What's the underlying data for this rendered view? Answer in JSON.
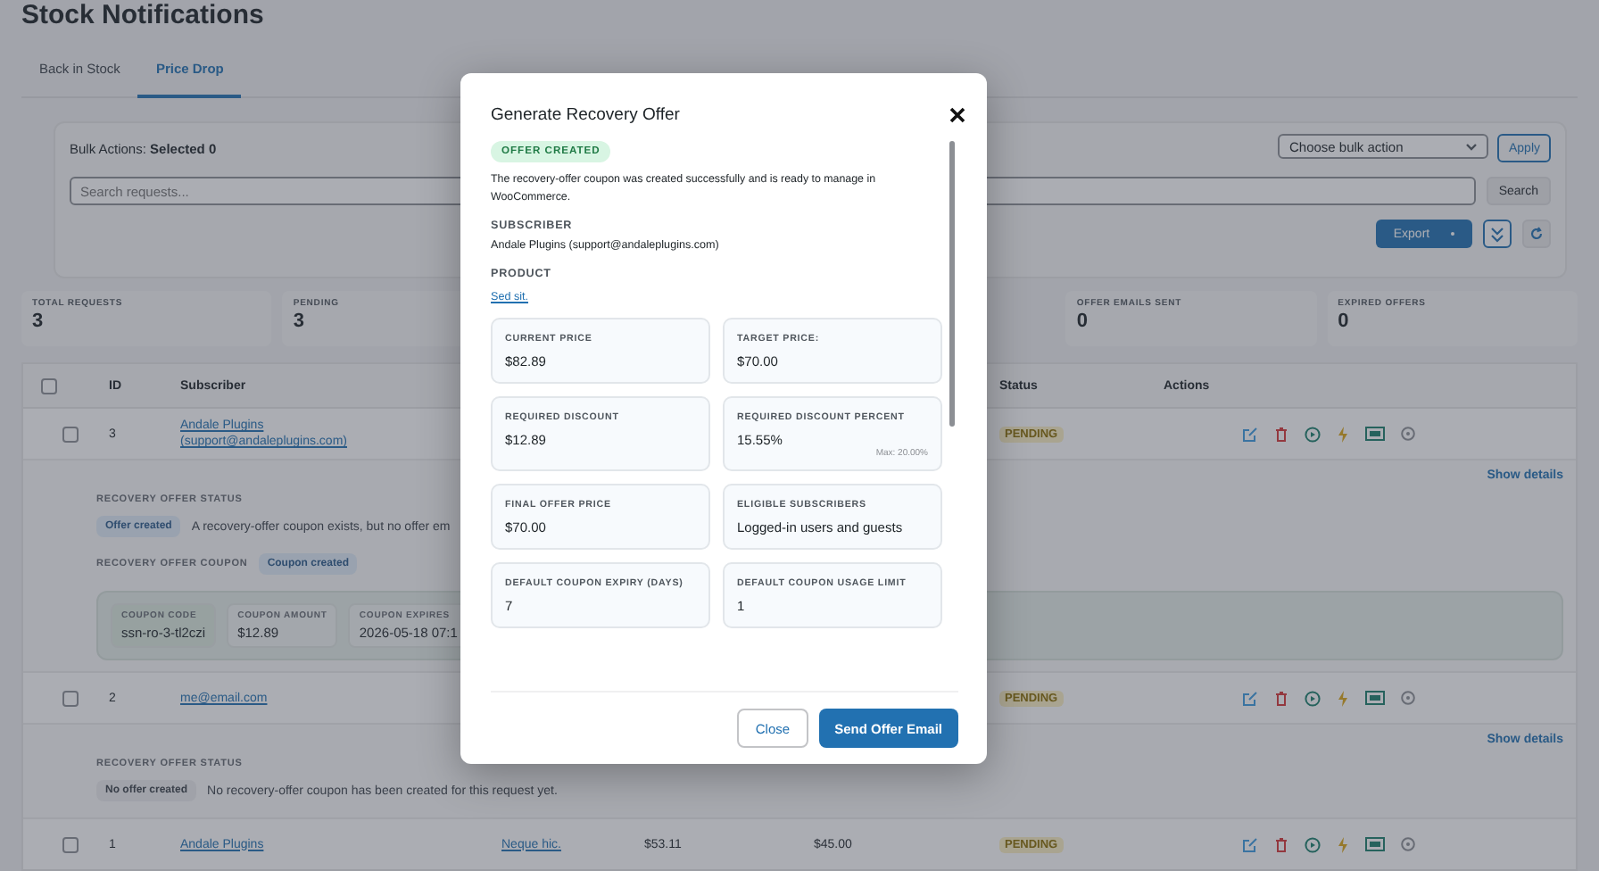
{
  "page": {
    "title": "Stock Notifications"
  },
  "tabs": [
    {
      "label": "Back in Stock",
      "selected": false
    },
    {
      "label": "Price Drop",
      "selected": true
    }
  ],
  "toolbar": {
    "bulk_label": "Bulk Actions: **Selected 0**",
    "bulk_select": "Choose bulk action",
    "apply": "Apply",
    "search_placeholder": "Search requests...",
    "search_button": "Search",
    "export": "Export"
  },
  "stats_left": [
    {
      "label": "TOTAL REQUESTS",
      "value": "3"
    },
    {
      "label": "PENDING",
      "value": "3"
    }
  ],
  "stats_right": [
    {
      "label": "OFFER EMAILS SENT",
      "value": "0"
    },
    {
      "label": "EXPIRED OFFERS",
      "value": "0"
    }
  ],
  "table": {
    "select_all_checked": false,
    "headers": {
      "id": "ID",
      "subscriber": "Subscriber",
      "status": "Status",
      "actions": "Actions"
    },
    "rows": [
      {
        "id": "3",
        "checked": false,
        "subscriber": "Andale Plugins (support@andaleplugins.com)",
        "status": "PENDING",
        "details": {
          "toggle": "Show details",
          "status_heading": "RECOVERY OFFER STATUS",
          "status_badge": {
            "label": "Offer created",
            "kind": "created"
          },
          "status_text": "A recovery-offer coupon exists, but no offer em",
          "coupon": {
            "heading": "RECOVERY OFFER COUPON",
            "badge": "Coupon created",
            "fields": [
              {
                "label": "COUPON CODE",
                "value": "ssn-ro-3-tl2czi",
                "highlight": true
              },
              {
                "label": "COUPON AMOUNT",
                "value": "$12.89",
                "highlight": false
              },
              {
                "label": "COUPON EXPIRES",
                "value": "2026-05-18 07:1",
                "highlight": false
              }
            ]
          }
        }
      },
      {
        "id": "2",
        "checked": false,
        "subscriber": "me@email.com",
        "status": "PENDING",
        "details": {
          "toggle": "Show details",
          "status_heading": "RECOVERY OFFER STATUS",
          "status_badge": {
            "label": "No offer created",
            "kind": "none"
          },
          "status_text": "No recovery-offer coupon has been created for this request yet."
        }
      },
      {
        "id": "1",
        "checked": false,
        "subscriber": "Andale Plugins",
        "product": "Neque hic.",
        "current_price": "$53.11",
        "target_price": "$45.00",
        "status": "PENDING"
      }
    ]
  },
  "modal": {
    "title": "Generate Recovery Offer",
    "badge": "OFFER CREATED",
    "message": "The recovery-offer coupon was created successfully and is ready to manage in WooCommerce.",
    "subscriber_label": "SUBSCRIBER",
    "subscriber": "Andale Plugins (support@andaleplugins.com)",
    "product_label": "PRODUCT",
    "product": "Sed sit.",
    "cards": [
      {
        "label": "CURRENT PRICE",
        "value": "$82.89"
      },
      {
        "label": "TARGET PRICE:",
        "value": "$70.00"
      },
      {
        "label": "REQUIRED DISCOUNT",
        "value": "$12.89"
      },
      {
        "label": "REQUIRED DISCOUNT PERCENT",
        "value": "15.55%",
        "note": "Max: 20.00%"
      },
      {
        "label": "FINAL OFFER PRICE",
        "value": "$70.00"
      },
      {
        "label": "ELIGIBLE SUBSCRIBERS",
        "value": "Logged-in users and guests"
      },
      {
        "label": "DEFAULT COUPON EXPIRY (DAYS)",
        "value": "7"
      },
      {
        "label": "DEFAULT COUPON USAGE LIMIT",
        "value": "1"
      }
    ],
    "close": "Close",
    "send": "Send Offer Email"
  }
}
